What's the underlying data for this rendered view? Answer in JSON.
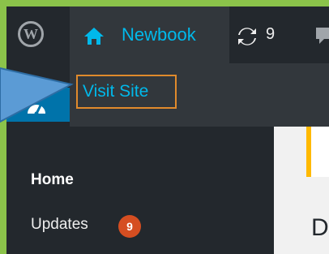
{
  "adminbar": {
    "site_name": "Newbook",
    "updates_count": "9",
    "icons": [
      "wordpress-logo-icon",
      "home-icon",
      "updates-icon",
      "comment-icon"
    ]
  },
  "dropdown": {
    "visit_site": "Visit Site"
  },
  "sidebar": {
    "items": [
      {
        "label": "Home",
        "active": true
      },
      {
        "label": "Updates",
        "badge": "9"
      }
    ]
  },
  "content": {
    "heading_partial": "D"
  },
  "colors": {
    "accent": "#00b9eb",
    "badge": "#d54e21",
    "annotation_border": "#e08a2c",
    "frame_border": "#8bc34a"
  }
}
